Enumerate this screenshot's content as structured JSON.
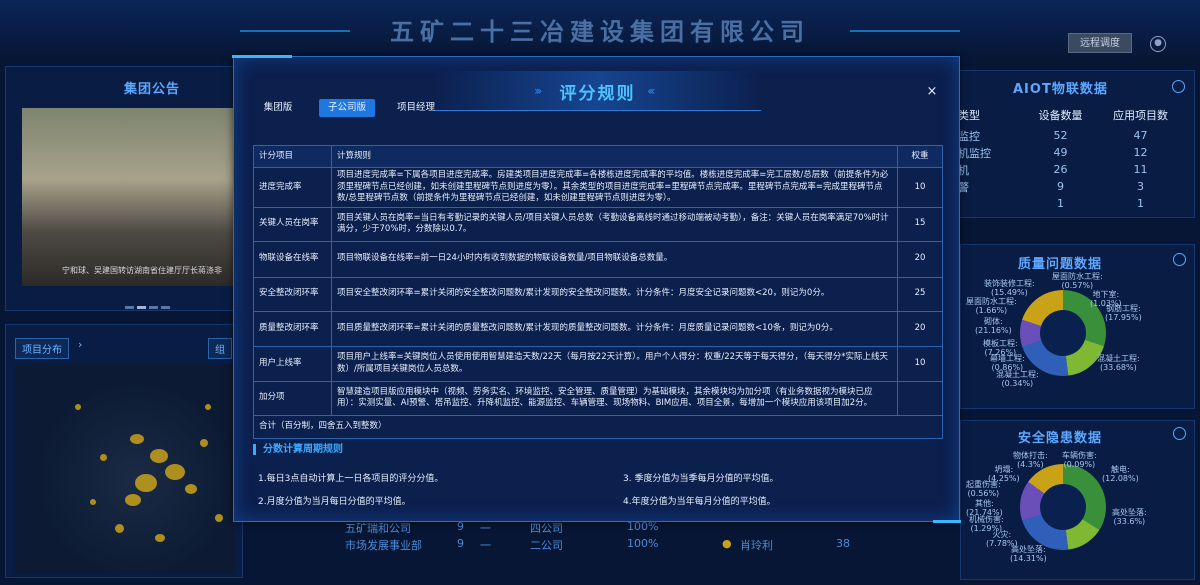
{
  "header": {
    "company_title": "五矿二十三冶建设集团有限公司",
    "remote_button": "远程调度"
  },
  "background": {
    "announce_title": "集团公告",
    "announce_caption": "宁和球、吴建国转访湖南省住建厅厅长蒋涤非",
    "project_tab": "项目分布",
    "project_tab2": "组",
    "aiot_title": "AIOT物联数据",
    "aiot_headers": [
      "类型",
      "设备数量",
      "应用项目数"
    ],
    "aiot_rows": [
      [
        "监控",
        "52",
        "47"
      ],
      [
        "机监控",
        "49",
        "12"
      ],
      [
        "机",
        "26",
        "11"
      ],
      [
        "警",
        "9",
        "3"
      ],
      [
        "",
        "1",
        "1"
      ]
    ],
    "quality_title": "质量问题数据",
    "quality_labels": [
      "装饰装修工程:\n(15.49%)",
      "屋面防水工程:\n(0.57%)",
      "地下室:\n(1.03%)",
      "屋面防水工程:\n(1.66%)",
      "钢筋工程:\n(17.95%)",
      "砌体:\n(21.16%)",
      "模板工程:\n(7.26%)",
      "幕墙工程:\n(0.86%)",
      "混凝土工程:\n(33.68%)",
      "混凝土工程:\n(0.34%)"
    ],
    "safety_title": "安全隐患数据",
    "safety_labels": [
      "物体打击:\n(4.3%)",
      "车辆伤害:\n(0.09%)",
      "触电:\n(12.08%)",
      "坍塌:\n(4.25%)",
      "起重伤害:\n(0.56%)",
      "其他:\n(21.74%)",
      "机械伤害:\n(1.29%)",
      "火灾:\n(7.78%)",
      "高处坠落:\n(33.6%)",
      "高处坠落:\n(14.31%)"
    ],
    "bottom_rows": [
      [
        "五矿瑞和公司",
        "9",
        "一",
        "四公司",
        "100%"
      ],
      [
        "市场发展事业部",
        "9",
        "一",
        "二公司",
        "100%",
        "肖玲利",
        "38"
      ]
    ]
  },
  "modal": {
    "title": "评分规则",
    "close_symbol": "×",
    "tabs": [
      "集团版",
      "子公司版",
      "项目经理"
    ],
    "active_tab": "子公司版",
    "table_headers": [
      "计分项目",
      "计算规则",
      "权重"
    ],
    "rows": [
      {
        "item": "进度完成率",
        "rule": "项目进度完成率=下属各项目进度完成率。房建类项目进度完成率=各楼栋进度完成率的平均值。楼栋进度完成率=完工层数/总层数（前提条件为必须里程碑节点已经创建，如未创建里程碑节点则进度为零）。其余类型的项目进度完成率=里程碑节点完成率。里程碑节点完成率=完成里程碑节点数/总里程碑节点数（前提条件为里程碑节点已经创建，如未创建里程碑节点则进度为零）。",
        "weight": "10"
      },
      {
        "item": "关键人员在岗率",
        "rule": "项目关键人员在岗率=当日有考勤记录的关键人员/项目关键人员总数（考勤设备离线时通过移动端被动考勤），备注：关键人员在岗率满足70%时计满分，少于70%时，分数除以0.7。",
        "weight": "15"
      },
      {
        "item": "物联设备在线率",
        "rule": "项目物联设备在线率=前一日24小时内有收到数据的物联设备数量/项目物联设备总数量。",
        "weight": "20"
      },
      {
        "item": "安全整改闭环率",
        "rule": "项目安全整改闭环率=累计关闭的安全整改问题数/累计发现的安全整改问题数。计分条件：月度安全记录问题数<20，则记为0分。",
        "weight": "25"
      },
      {
        "item": "质量整改闭环率",
        "rule": "项目质量整改闭环率=累计关闭的质量整改问题数/累计发现的质量整改问题数。计分条件：月度质量记录问题数<10条，则记为0分。",
        "weight": "20"
      },
      {
        "item": "用户上线率",
        "rule": "项目用户上线率=关键岗位人员使用使用智慧建造天数/22天（每月按22天计算）。用户个人得分：权重/22天等于每天得分，（每天得分*实际上线天数）/所属项目关键岗位人员总数。",
        "weight": "10"
      },
      {
        "item": "加分项",
        "rule": "智慧建造项目版应用模块中（视频、劳务实名、环境监控、安全管理、质量管理）为基础模块，其余模块均为加分项（有业务数据视为模块已应用）：实测实量、AI预警、塔吊监控、升降机监控、能源监控、车辆管理、现场物料、BIM应用、项目全景，每增加一个模块应用该项目加2分。",
        "weight": ""
      }
    ],
    "total_row": "合计（百分制，四舍五入到整数）",
    "section_title": "分数计算周期规则",
    "period_notes": [
      "1.每日3点自动计算上一日各项目的评分分值。",
      "3. 季度分值为当季每月分值的平均值。",
      "2.月度分值为当月每日分值的平均值。",
      "4.年度分值为当年每月分值的平均值。"
    ]
  }
}
